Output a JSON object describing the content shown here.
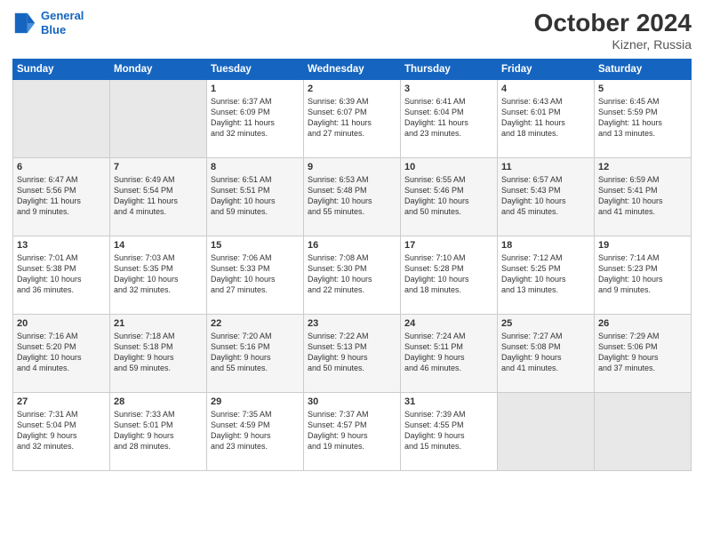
{
  "header": {
    "logo_line1": "General",
    "logo_line2": "Blue",
    "title": "October 2024",
    "subtitle": "Kizner, Russia"
  },
  "days_of_week": [
    "Sunday",
    "Monday",
    "Tuesday",
    "Wednesday",
    "Thursday",
    "Friday",
    "Saturday"
  ],
  "weeks": [
    [
      {
        "day": "",
        "content": ""
      },
      {
        "day": "",
        "content": ""
      },
      {
        "day": "1",
        "content": "Sunrise: 6:37 AM\nSunset: 6:09 PM\nDaylight: 11 hours\nand 32 minutes."
      },
      {
        "day": "2",
        "content": "Sunrise: 6:39 AM\nSunset: 6:07 PM\nDaylight: 11 hours\nand 27 minutes."
      },
      {
        "day": "3",
        "content": "Sunrise: 6:41 AM\nSunset: 6:04 PM\nDaylight: 11 hours\nand 23 minutes."
      },
      {
        "day": "4",
        "content": "Sunrise: 6:43 AM\nSunset: 6:01 PM\nDaylight: 11 hours\nand 18 minutes."
      },
      {
        "day": "5",
        "content": "Sunrise: 6:45 AM\nSunset: 5:59 PM\nDaylight: 11 hours\nand 13 minutes."
      }
    ],
    [
      {
        "day": "6",
        "content": "Sunrise: 6:47 AM\nSunset: 5:56 PM\nDaylight: 11 hours\nand 9 minutes."
      },
      {
        "day": "7",
        "content": "Sunrise: 6:49 AM\nSunset: 5:54 PM\nDaylight: 11 hours\nand 4 minutes."
      },
      {
        "day": "8",
        "content": "Sunrise: 6:51 AM\nSunset: 5:51 PM\nDaylight: 10 hours\nand 59 minutes."
      },
      {
        "day": "9",
        "content": "Sunrise: 6:53 AM\nSunset: 5:48 PM\nDaylight: 10 hours\nand 55 minutes."
      },
      {
        "day": "10",
        "content": "Sunrise: 6:55 AM\nSunset: 5:46 PM\nDaylight: 10 hours\nand 50 minutes."
      },
      {
        "day": "11",
        "content": "Sunrise: 6:57 AM\nSunset: 5:43 PM\nDaylight: 10 hours\nand 45 minutes."
      },
      {
        "day": "12",
        "content": "Sunrise: 6:59 AM\nSunset: 5:41 PM\nDaylight: 10 hours\nand 41 minutes."
      }
    ],
    [
      {
        "day": "13",
        "content": "Sunrise: 7:01 AM\nSunset: 5:38 PM\nDaylight: 10 hours\nand 36 minutes."
      },
      {
        "day": "14",
        "content": "Sunrise: 7:03 AM\nSunset: 5:35 PM\nDaylight: 10 hours\nand 32 minutes."
      },
      {
        "day": "15",
        "content": "Sunrise: 7:06 AM\nSunset: 5:33 PM\nDaylight: 10 hours\nand 27 minutes."
      },
      {
        "day": "16",
        "content": "Sunrise: 7:08 AM\nSunset: 5:30 PM\nDaylight: 10 hours\nand 22 minutes."
      },
      {
        "day": "17",
        "content": "Sunrise: 7:10 AM\nSunset: 5:28 PM\nDaylight: 10 hours\nand 18 minutes."
      },
      {
        "day": "18",
        "content": "Sunrise: 7:12 AM\nSunset: 5:25 PM\nDaylight: 10 hours\nand 13 minutes."
      },
      {
        "day": "19",
        "content": "Sunrise: 7:14 AM\nSunset: 5:23 PM\nDaylight: 10 hours\nand 9 minutes."
      }
    ],
    [
      {
        "day": "20",
        "content": "Sunrise: 7:16 AM\nSunset: 5:20 PM\nDaylight: 10 hours\nand 4 minutes."
      },
      {
        "day": "21",
        "content": "Sunrise: 7:18 AM\nSunset: 5:18 PM\nDaylight: 9 hours\nand 59 minutes."
      },
      {
        "day": "22",
        "content": "Sunrise: 7:20 AM\nSunset: 5:16 PM\nDaylight: 9 hours\nand 55 minutes."
      },
      {
        "day": "23",
        "content": "Sunrise: 7:22 AM\nSunset: 5:13 PM\nDaylight: 9 hours\nand 50 minutes."
      },
      {
        "day": "24",
        "content": "Sunrise: 7:24 AM\nSunset: 5:11 PM\nDaylight: 9 hours\nand 46 minutes."
      },
      {
        "day": "25",
        "content": "Sunrise: 7:27 AM\nSunset: 5:08 PM\nDaylight: 9 hours\nand 41 minutes."
      },
      {
        "day": "26",
        "content": "Sunrise: 7:29 AM\nSunset: 5:06 PM\nDaylight: 9 hours\nand 37 minutes."
      }
    ],
    [
      {
        "day": "27",
        "content": "Sunrise: 7:31 AM\nSunset: 5:04 PM\nDaylight: 9 hours\nand 32 minutes."
      },
      {
        "day": "28",
        "content": "Sunrise: 7:33 AM\nSunset: 5:01 PM\nDaylight: 9 hours\nand 28 minutes."
      },
      {
        "day": "29",
        "content": "Sunrise: 7:35 AM\nSunset: 4:59 PM\nDaylight: 9 hours\nand 23 minutes."
      },
      {
        "day": "30",
        "content": "Sunrise: 7:37 AM\nSunset: 4:57 PM\nDaylight: 9 hours\nand 19 minutes."
      },
      {
        "day": "31",
        "content": "Sunrise: 7:39 AM\nSunset: 4:55 PM\nDaylight: 9 hours\nand 15 minutes."
      },
      {
        "day": "",
        "content": ""
      },
      {
        "day": "",
        "content": ""
      }
    ]
  ]
}
